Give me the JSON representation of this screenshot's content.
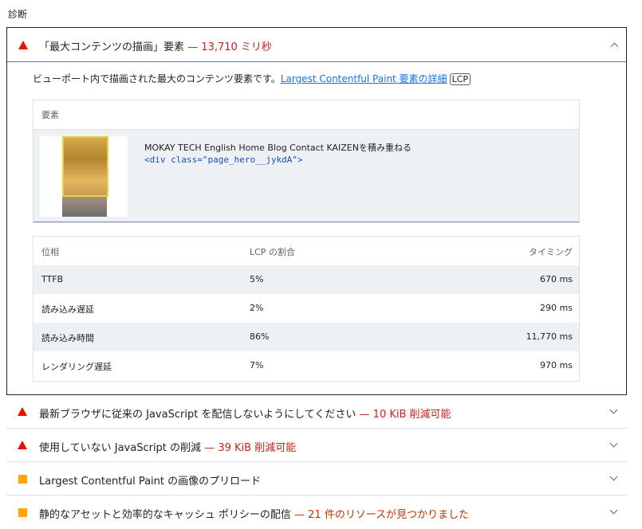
{
  "section_title": "診断",
  "lcp_audit": {
    "title": "「最大コンテンツの描画」要素",
    "separator": "—",
    "display_value": "13,710 ミリ秒",
    "description": "ビューポート内で描画された最大のコンテンツ要素です。",
    "learn_more_link": "Largest Contentful Paint 要素の詳細",
    "lcp_tag": "LCP",
    "element_table": {
      "header": "要素",
      "node_label": "MOKAY TECH English Home Blog Contact KAIZENを積み重ねる",
      "node_snippet": "<div class=\"page_hero__jykdA\">"
    },
    "phase_table": {
      "headers": [
        "位相",
        "LCP の割合",
        "タイミング"
      ],
      "rows": [
        {
          "phase": "TTFB",
          "percent": "5%",
          "timing": "670 ms"
        },
        {
          "phase": "読み込み遅延",
          "percent": "2%",
          "timing": "290 ms"
        },
        {
          "phase": "読み込み時間",
          "percent": "86%",
          "timing": "11,770 ms"
        },
        {
          "phase": "レンダリング遅延",
          "percent": "7%",
          "timing": "970 ms"
        }
      ]
    }
  },
  "audits": [
    {
      "title": "最新ブラウザに従来の JavaScript を配信しないようにしてください",
      "separator": "—",
      "display_value": "10 KiB 削減可能",
      "severity": "fail"
    },
    {
      "title": "使用していない JavaScript の削減",
      "separator": "—",
      "display_value": "39 KiB 削減可能",
      "severity": "fail"
    },
    {
      "title": "Largest Contentful Paint の画像のプリロード",
      "separator": "",
      "display_value": "",
      "severity": "average"
    },
    {
      "title": "静的なアセットと効率的なキャッシュ ポリシーの配信",
      "separator": "—",
      "display_value": "21 件のリソースが見つかりました",
      "severity": "average"
    }
  ],
  "colors": {
    "fail": "#eb0f00",
    "fail_text": "#c5221f",
    "average": "#ffa400",
    "average_text": "#c33300",
    "link": "#1a73e8"
  }
}
